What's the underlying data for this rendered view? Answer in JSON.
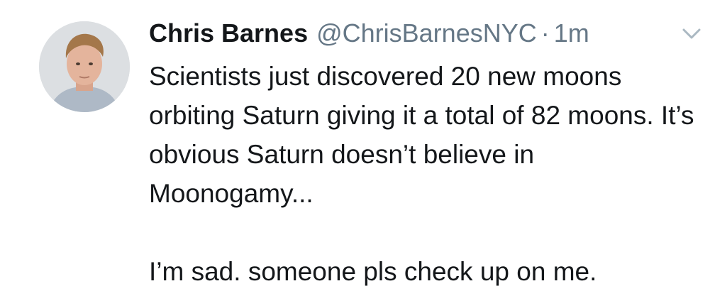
{
  "tweet": {
    "author": {
      "display_name": "Chris Barnes",
      "handle": "@ChrisBarnesNYC",
      "avatar_icon": "profile-photo"
    },
    "separator": "·",
    "time": "1m",
    "menu_icon": "chevron-down-icon",
    "text": {
      "paragraph1": "Scientists just discovered 20 new moons orbiting Saturn giving it a total of 82 moons. It’s obvious Saturn doesn’t believe in Moonogamy...",
      "paragraph2": "I’m sad. someone pls check up on me."
    }
  },
  "colors": {
    "text": "#14171a",
    "secondary": "#657786",
    "background": "#ffffff"
  }
}
